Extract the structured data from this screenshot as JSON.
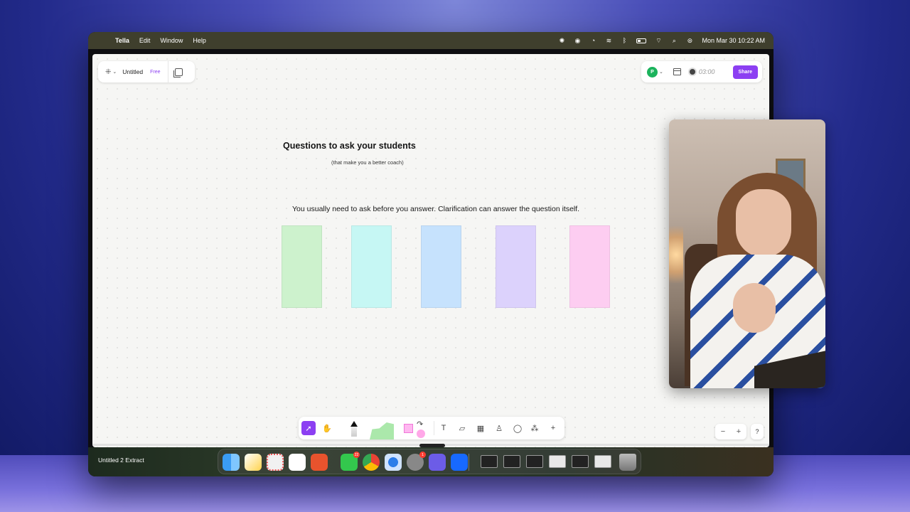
{
  "menubar": {
    "app_name": "Tella",
    "items": [
      "Edit",
      "Window",
      "Help"
    ],
    "datetime": "Mon Mar 30  10:22 AM"
  },
  "topbar_left": {
    "doc_title": "Untitled",
    "plan_badge": "Free"
  },
  "topbar_right": {
    "avatar_initial": "P",
    "timer": "03:00",
    "share_label": "Share"
  },
  "canvas": {
    "title": "Questions to ask your students",
    "subtitle": "(that make you a better coach)",
    "body_text": "You usually need to ask before you answer. Clarification can answer the question itself.",
    "sticky_colors": [
      "#cdf2cd",
      "#c6f7f4",
      "#c6e2fd",
      "#dcd2fc",
      "#fdcdf1"
    ]
  },
  "colors": {
    "accent": "#8c3ff2",
    "menubar_bg": "#3f3f2d"
  },
  "zoom": {
    "minus": "−",
    "plus": "+"
  },
  "help_label": "?",
  "dock": {
    "active_window_label": "Untitled 2 Extract",
    "messages_badge": "22",
    "settings_badge": "1"
  }
}
